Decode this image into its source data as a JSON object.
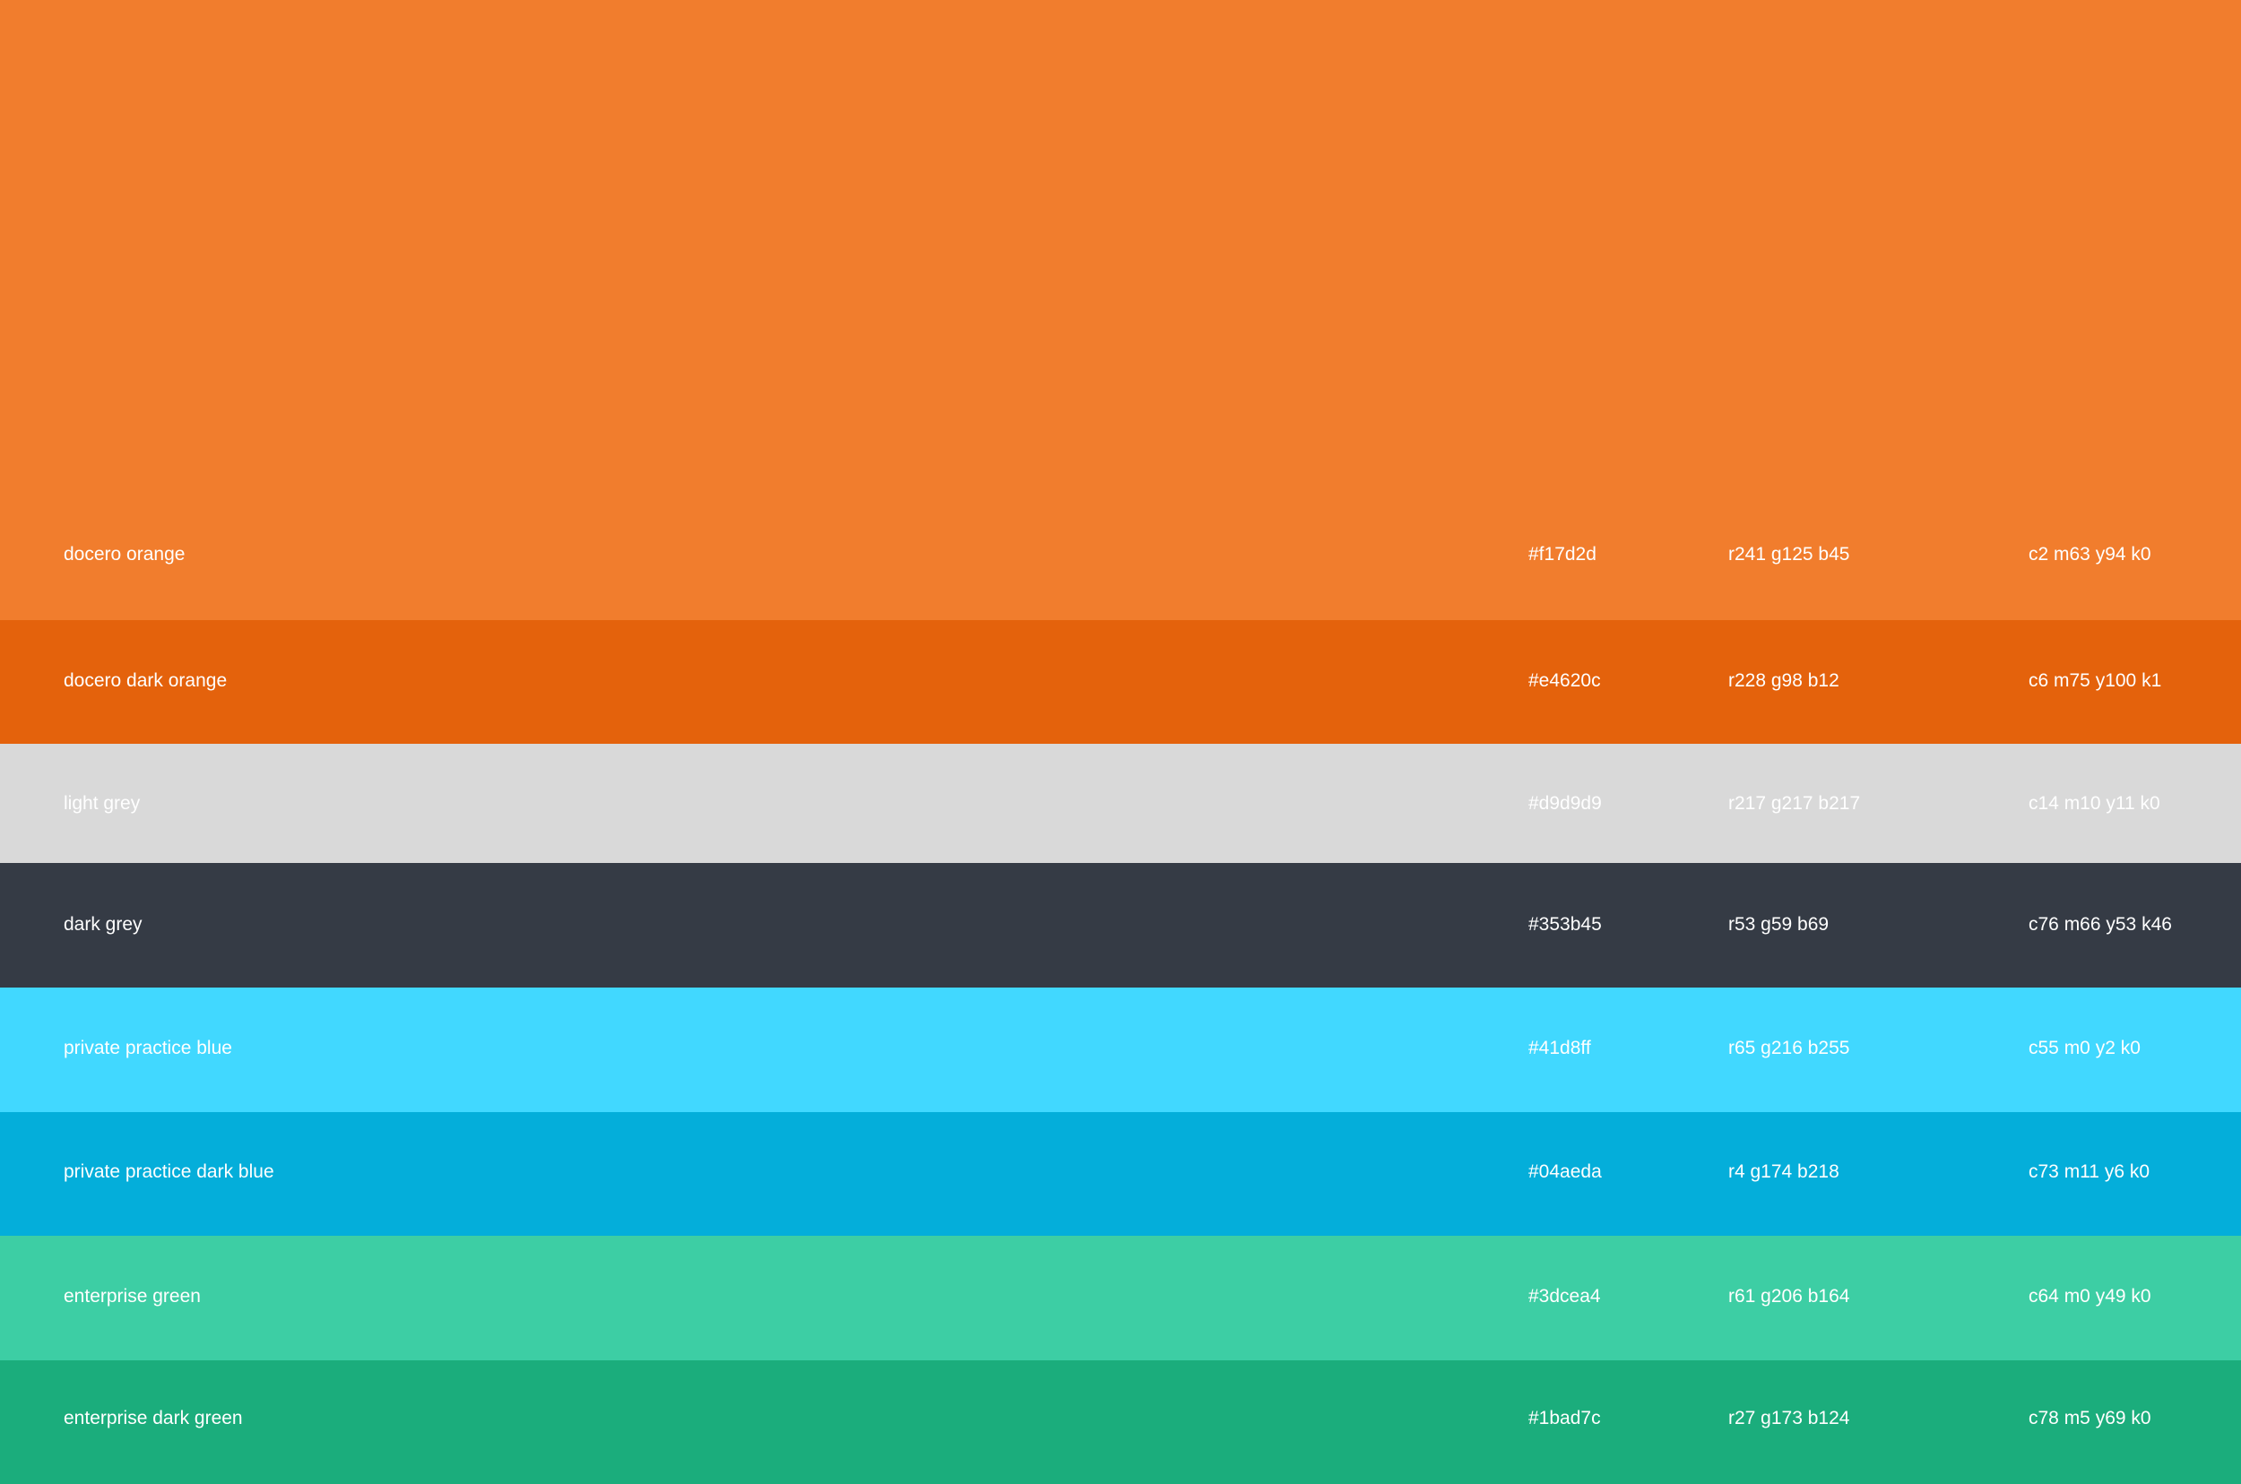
{
  "swatches": [
    {
      "name": "docero orange",
      "hex": "#f17d2d",
      "rgb": "r241 g125 b45",
      "cmyk": "c2 m63 y94 k0",
      "color": "#f17d2d"
    },
    {
      "name": "docero dark orange",
      "hex": "#e4620c",
      "rgb": "r228 g98 b12",
      "cmyk": "c6 m75 y100 k1",
      "color": "#e4620c"
    },
    {
      "name": "light grey",
      "hex": "#d9d9d9",
      "rgb": "r217 g217 b217",
      "cmyk": "c14 m10 y11 k0",
      "color": "#d9d9d9"
    },
    {
      "name": "dark grey",
      "hex": "#353b45",
      "rgb": "r53 g59 b69",
      "cmyk": "c76 m66 y53 k46",
      "color": "#353b45"
    },
    {
      "name": "private practice blue",
      "hex": "#41d8ff",
      "rgb": "r65 g216 b255",
      "cmyk": "c55 m0 y2 k0",
      "color": "#41d8ff"
    },
    {
      "name": "private practice dark blue",
      "hex": "#04aeda",
      "rgb": "r4 g174 b218",
      "cmyk": "c73 m11 y6 k0",
      "color": "#04aeda"
    },
    {
      "name": "enterprise green",
      "hex": "#3dcea4",
      "rgb": "r61 g206 b164",
      "cmyk": "c64 m0 y49 k0",
      "color": "#3dcea4"
    },
    {
      "name": "enterprise dark green",
      "hex": "#1bad7c",
      "rgb": "r27 g173 b124",
      "cmyk": "c78 m5 y69 k0",
      "color": "#1bad7c"
    }
  ]
}
